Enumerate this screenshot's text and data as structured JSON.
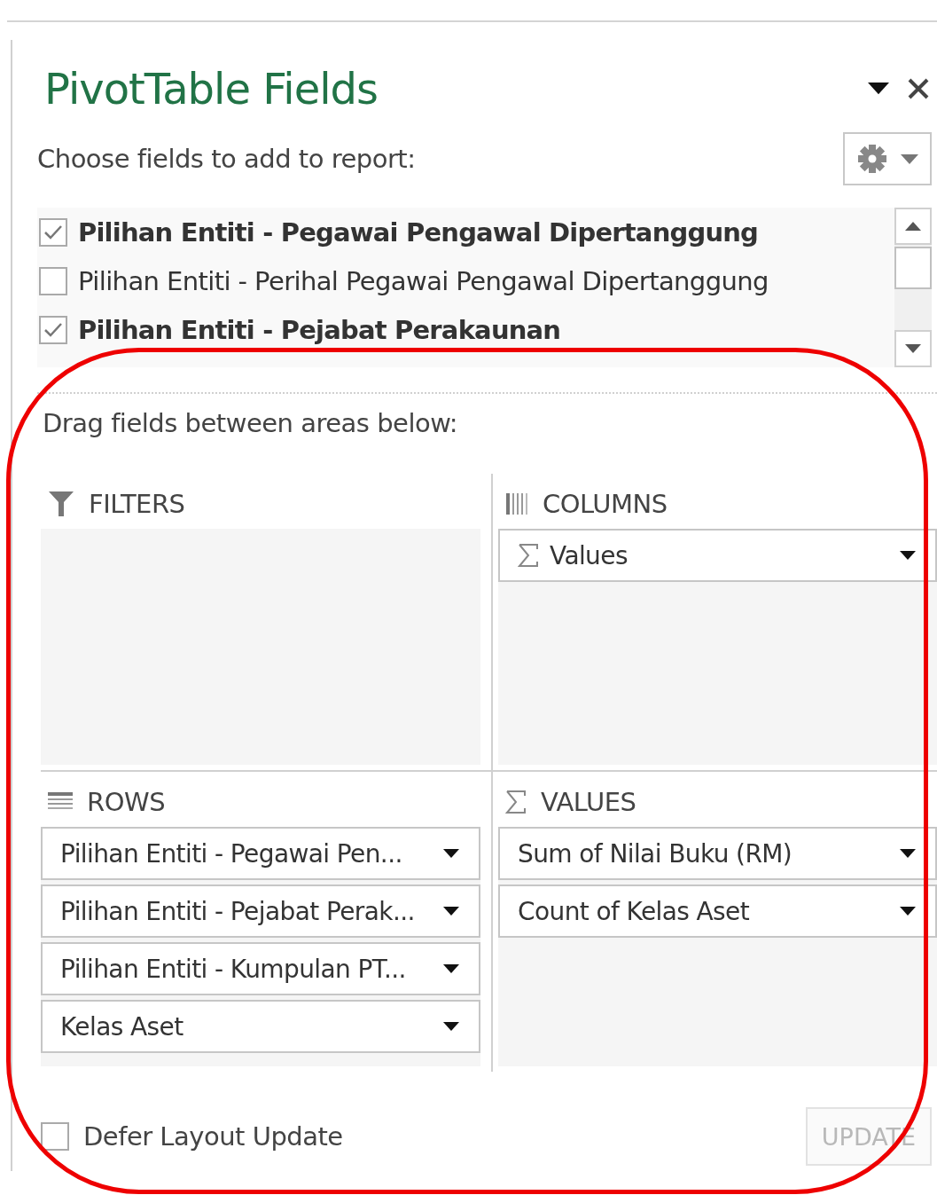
{
  "panel": {
    "title": "PivotTable Fields",
    "subtitle": "Choose fields to add to report:",
    "fields": [
      {
        "label": "Pilihan Entiti - Pegawai Pengawal Dipertanggung",
        "checked": true
      },
      {
        "label": "Pilihan Entiti - Perihal Pegawai Pengawal Dipertanggung",
        "checked": false
      },
      {
        "label": "Pilihan Entiti - Pejabat Perakaunan",
        "checked": true
      }
    ],
    "areas_hint": "Drag fields between areas below:",
    "areas": [
      {
        "kind": "filters",
        "label": "FILTERS"
      },
      {
        "kind": "columns",
        "label": "COLUMNS",
        "items": [
          {
            "label": "Values",
            "sigma": true
          }
        ]
      },
      {
        "kind": "rows",
        "label": "ROWS",
        "items": [
          {
            "label": "Pilihan Entiti - Pegawai Pen...",
            "sigma": false
          },
          {
            "label": "Pilihan Entiti - Pejabat Perak...",
            "sigma": false
          },
          {
            "label": "Pilihan Entiti - Kumpulan PT...",
            "sigma": false
          },
          {
            "label": "Kelas Aset",
            "sigma": false
          }
        ]
      },
      {
        "kind": "values",
        "label": "VALUES",
        "items": [
          {
            "label": "Sum of Nilai Buku (RM)",
            "sigma": false
          },
          {
            "label": "Count of Kelas Aset",
            "sigma": false
          }
        ]
      }
    ],
    "defer": {
      "label": "Defer Layout Update",
      "checked": false
    },
    "update_button": {
      "label": "UPDATE",
      "disabled": true
    }
  },
  "annotation": {
    "kind": "rounded-outline",
    "color": "#ee0000"
  }
}
